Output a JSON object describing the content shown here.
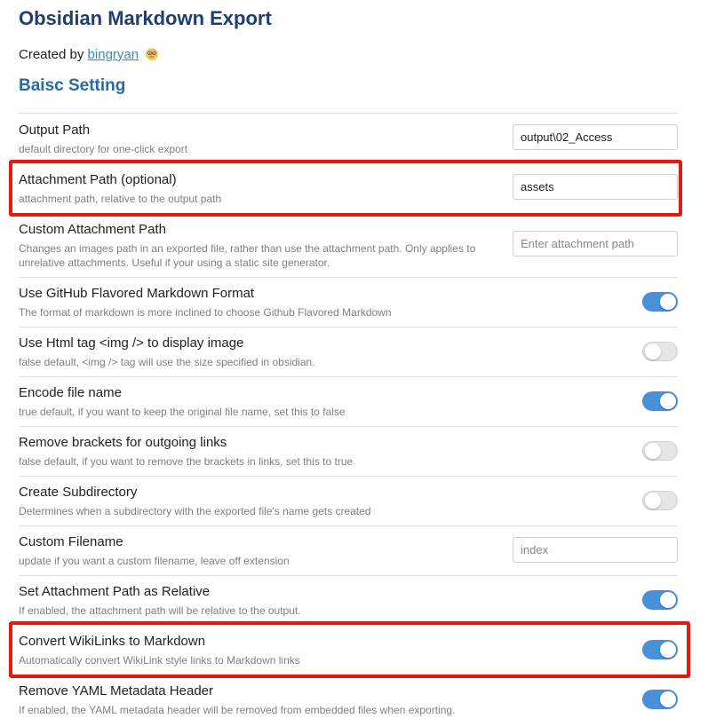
{
  "header": {
    "title": "Obsidian Markdown Export",
    "created_prefix": "Created by",
    "author": "bingryan",
    "author_emoji": "nerd-face-icon"
  },
  "section": {
    "title": "Baisc Setting"
  },
  "colors": {
    "heading": "#1f3f6e",
    "subheading": "#2a69a8",
    "link": "#3b88c4",
    "toggle_on": "#4a90d9",
    "highlight": "#e8170f"
  },
  "settings": [
    {
      "title": "Output Path",
      "desc": "default directory for one-click export",
      "control": "text",
      "value": "output\\02_Access",
      "placeholder": ""
    },
    {
      "title": "Attachment Path (optional)",
      "desc": "attachment path, relative to the output path",
      "control": "text",
      "value": "assets",
      "placeholder": "",
      "highlighted": true
    },
    {
      "title": "Custom Attachment Path",
      "desc": "Changes an images path in an exported file, rather than use the attachment path. Only applies to unrelative attachments. Useful if your using a static site generator.",
      "control": "text",
      "value": "",
      "placeholder": "Enter attachment path"
    },
    {
      "title": "Use GitHub Flavored Markdown Format",
      "desc": "The format of markdown is more inclined to choose Github Flavored Markdown",
      "control": "toggle",
      "enabled": true
    },
    {
      "title": "Use Html tag <img /> to display image",
      "desc": "false default, <img /> tag will use the size specified in obsidian.",
      "control": "toggle",
      "enabled": false
    },
    {
      "title": "Encode file name",
      "desc": "true default, if you want to keep the original file name, set this to false",
      "control": "toggle",
      "enabled": true
    },
    {
      "title": "Remove brackets for outgoing links",
      "desc": "false default, if you want to remove the brackets in links, set this to true",
      "control": "toggle",
      "enabled": false
    },
    {
      "title": "Create Subdirectory",
      "desc": "Determines when a subdirectory with the exported file's name gets created",
      "control": "toggle",
      "enabled": false
    },
    {
      "title": "Custom Filename",
      "desc": "update if you want a custom filename, leave off extension",
      "control": "text",
      "value": "",
      "placeholder": "index"
    },
    {
      "title": "Set Attachment Path as Relative",
      "desc": "If enabled, the attachment path will be relative to the output.",
      "control": "toggle",
      "enabled": true
    },
    {
      "title": "Convert WikiLinks to Markdown",
      "desc": "Automatically convert WikiLink style links to Markdown links",
      "control": "toggle",
      "enabled": true,
      "highlighted": true
    },
    {
      "title": "Remove YAML Metadata Header",
      "desc": "If enabled, the YAML metadata header will be removed from embedded files when exporting.",
      "control": "toggle",
      "enabled": true
    }
  ]
}
